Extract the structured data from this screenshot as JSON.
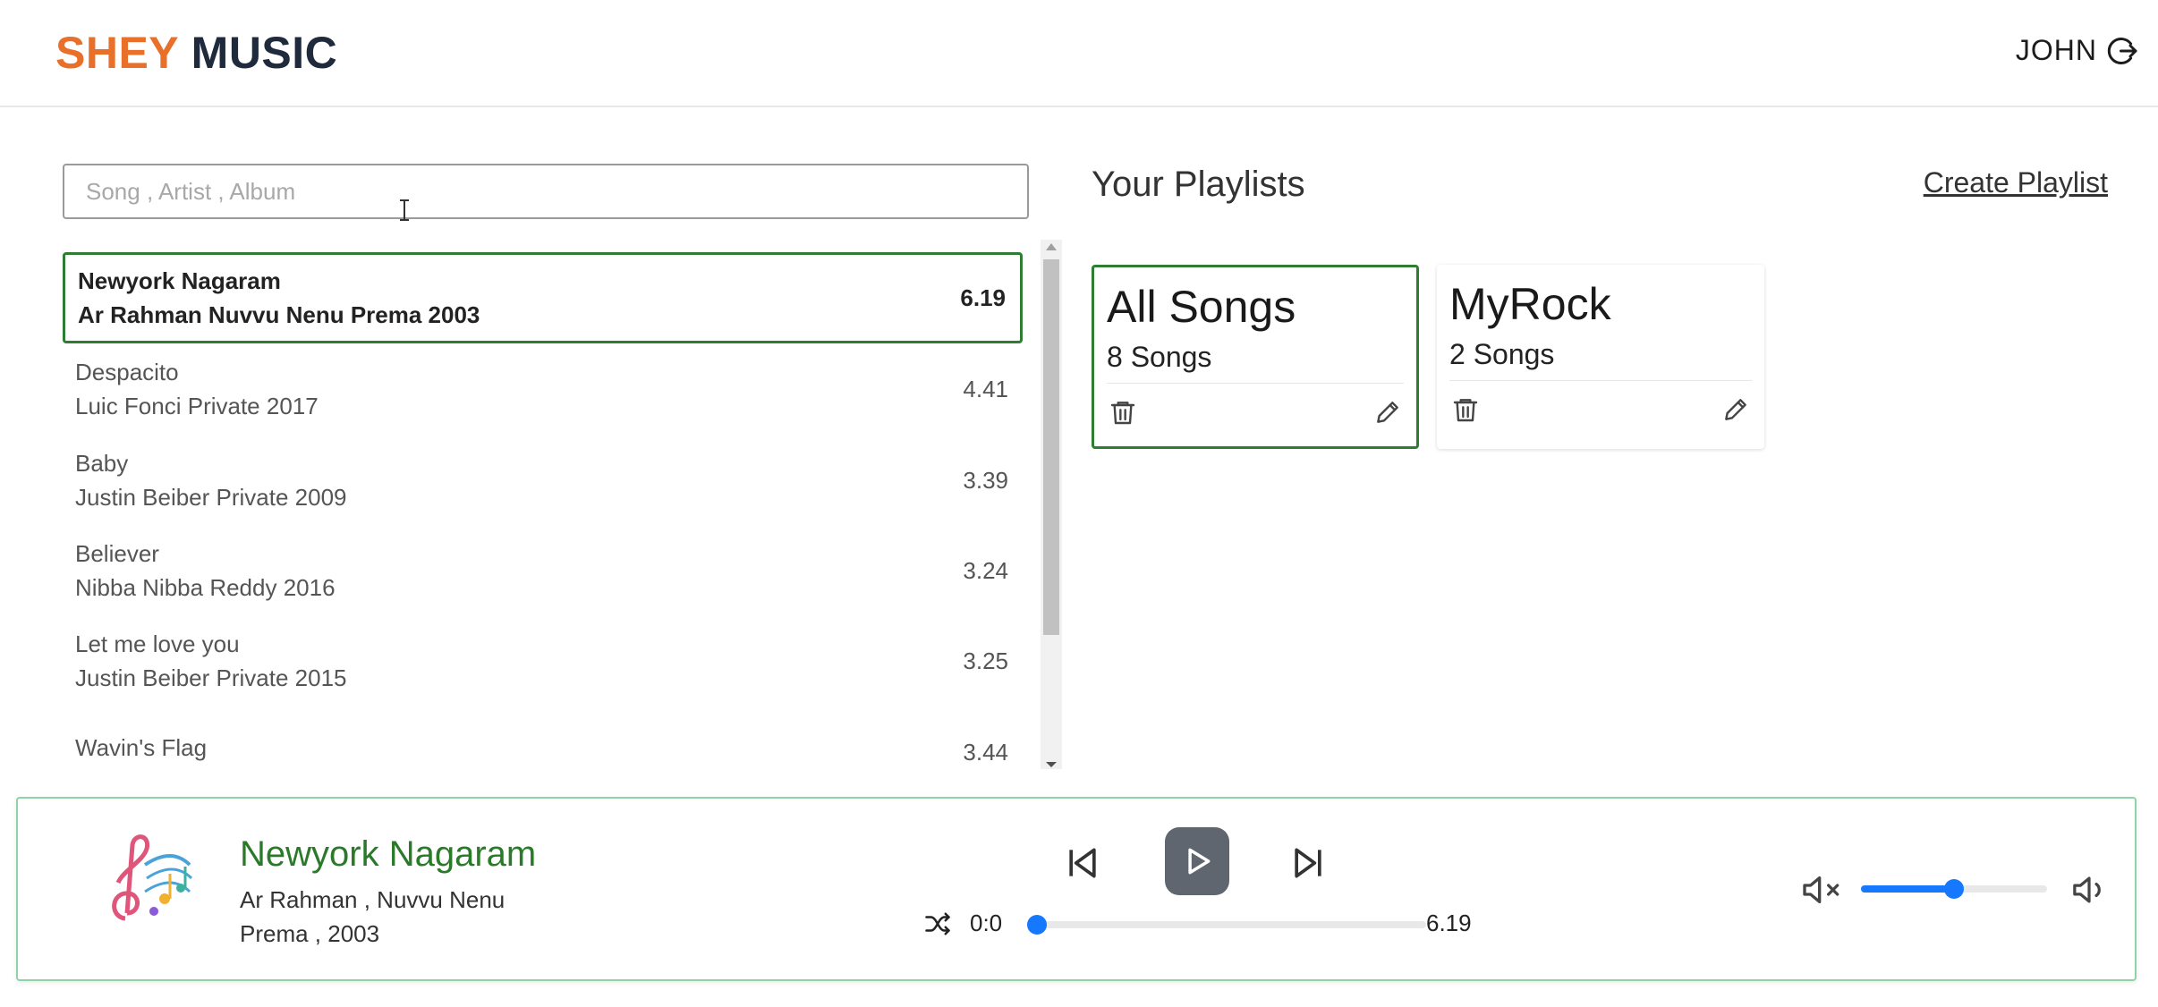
{
  "header": {
    "logo_part1": "SHEY",
    "logo_part2": "MUSIC",
    "user_name": "JOHN",
    "logout_icon": "logout-icon"
  },
  "search": {
    "placeholder": "Song , Artist , Album",
    "value": ""
  },
  "songs": [
    {
      "title": "Newyork Nagaram",
      "meta": "Ar Rahman Nuvvu Nenu Prema 2003",
      "duration": "6.19",
      "active": true
    },
    {
      "title": "Despacito",
      "meta": "Luic Fonci Private 2017",
      "duration": "4.41",
      "active": false
    },
    {
      "title": "Baby",
      "meta": "Justin Beiber Private 2009",
      "duration": "3.39",
      "active": false
    },
    {
      "title": "Believer",
      "meta": "Nibba Nibba Reddy 2016",
      "duration": "3.24",
      "active": false
    },
    {
      "title": "Let me love you",
      "meta": "Justin Beiber Private 2015",
      "duration": "3.25",
      "active": false
    },
    {
      "title": "Wavin's Flag",
      "meta": "",
      "duration": "3.44",
      "active": false
    }
  ],
  "playlists": {
    "title": "Your Playlists",
    "create_label": "Create Playlist",
    "items": [
      {
        "name": "All Songs",
        "count": "8 Songs",
        "active": true
      },
      {
        "name": "MyRock",
        "count": "2 Songs",
        "active": false
      }
    ]
  },
  "player": {
    "title": "Newyork Nagaram",
    "subtitle": "Ar Rahman , Nuvvu Nenu Prema , 2003",
    "current_time": "0:0",
    "total_time": "6.19",
    "progress": 0.0,
    "volume": 0.5,
    "colors": {
      "accent": "#1677ff",
      "title": "#2a7a2a",
      "active_border": "#2e7d32"
    }
  }
}
